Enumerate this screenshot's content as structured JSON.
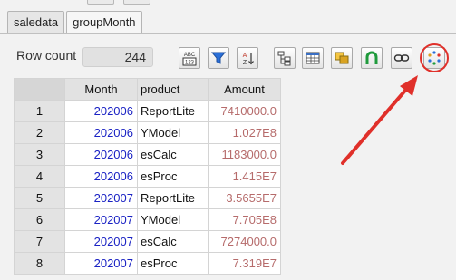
{
  "tabs": [
    {
      "label": "saledata",
      "active": false
    },
    {
      "label": "groupMonth",
      "active": true
    }
  ],
  "toolbar": {
    "row_count_label": "Row count",
    "row_count_value": "244",
    "buttons": [
      {
        "icon": "abc-123-icon"
      },
      {
        "icon": "filter-icon"
      },
      {
        "icon": "sort-az-icon"
      },
      {
        "icon": "tree-icon"
      },
      {
        "icon": "table-calc-icon"
      },
      {
        "icon": "layers-icon"
      },
      {
        "icon": "magnet-icon"
      },
      {
        "icon": "link-icon"
      },
      {
        "icon": "refresh-dots-icon"
      }
    ]
  },
  "table": {
    "columns": [
      "",
      "Month",
      "product",
      "Amount"
    ],
    "rows": [
      {
        "index": "1",
        "month": "202006",
        "product": "ReportLite",
        "amount": "7410000.0"
      },
      {
        "index": "2",
        "month": "202006",
        "product": "YModel",
        "amount": "1.027E8"
      },
      {
        "index": "3",
        "month": "202006",
        "product": "esCalc",
        "amount": "1183000.0"
      },
      {
        "index": "4",
        "month": "202006",
        "product": "esProc",
        "amount": "1.415E7"
      },
      {
        "index": "5",
        "month": "202007",
        "product": "ReportLite",
        "amount": "3.5655E7"
      },
      {
        "index": "6",
        "month": "202007",
        "product": "YModel",
        "amount": "7.705E8"
      },
      {
        "index": "7",
        "month": "202007",
        "product": "esCalc",
        "amount": "7274000.0"
      },
      {
        "index": "8",
        "month": "202007",
        "product": "esProc",
        "amount": "7.319E7"
      }
    ]
  },
  "colors": {
    "annotation": "#e0302a",
    "month_text": "#1a22c4",
    "amount_text": "#b66b6b"
  }
}
